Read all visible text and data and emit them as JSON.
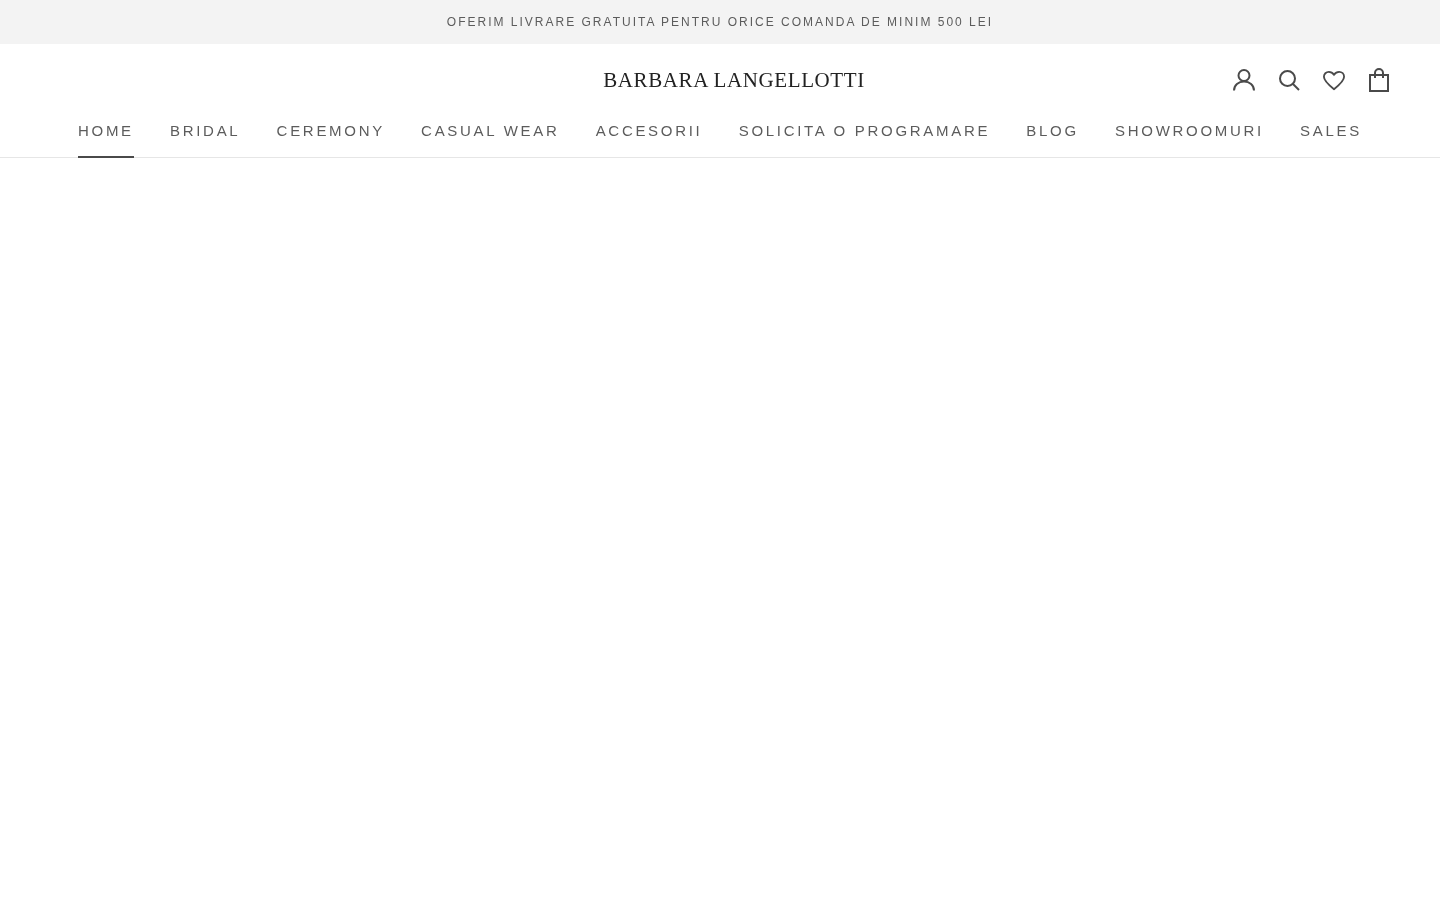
{
  "announcement": {
    "text": "OFERIM LIVRARE GRATUITA PENTRU ORICE COMANDA DE MINIM 500 LEI"
  },
  "header": {
    "logo": "BARBARA LANGELLOTTI"
  },
  "nav": [
    {
      "label": "HOME",
      "selected": true
    },
    {
      "label": "BRIDAL",
      "selected": false
    },
    {
      "label": "CEREMONY",
      "selected": false
    },
    {
      "label": "CASUAL WEAR",
      "selected": false
    },
    {
      "label": "ACCESORII",
      "selected": false
    },
    {
      "label": "SOLICITA O PROGRAMARE",
      "selected": false
    },
    {
      "label": "BLOG",
      "selected": false
    },
    {
      "label": "SHOWROOMURI",
      "selected": false
    },
    {
      "label": "SALES",
      "selected": false
    }
  ]
}
